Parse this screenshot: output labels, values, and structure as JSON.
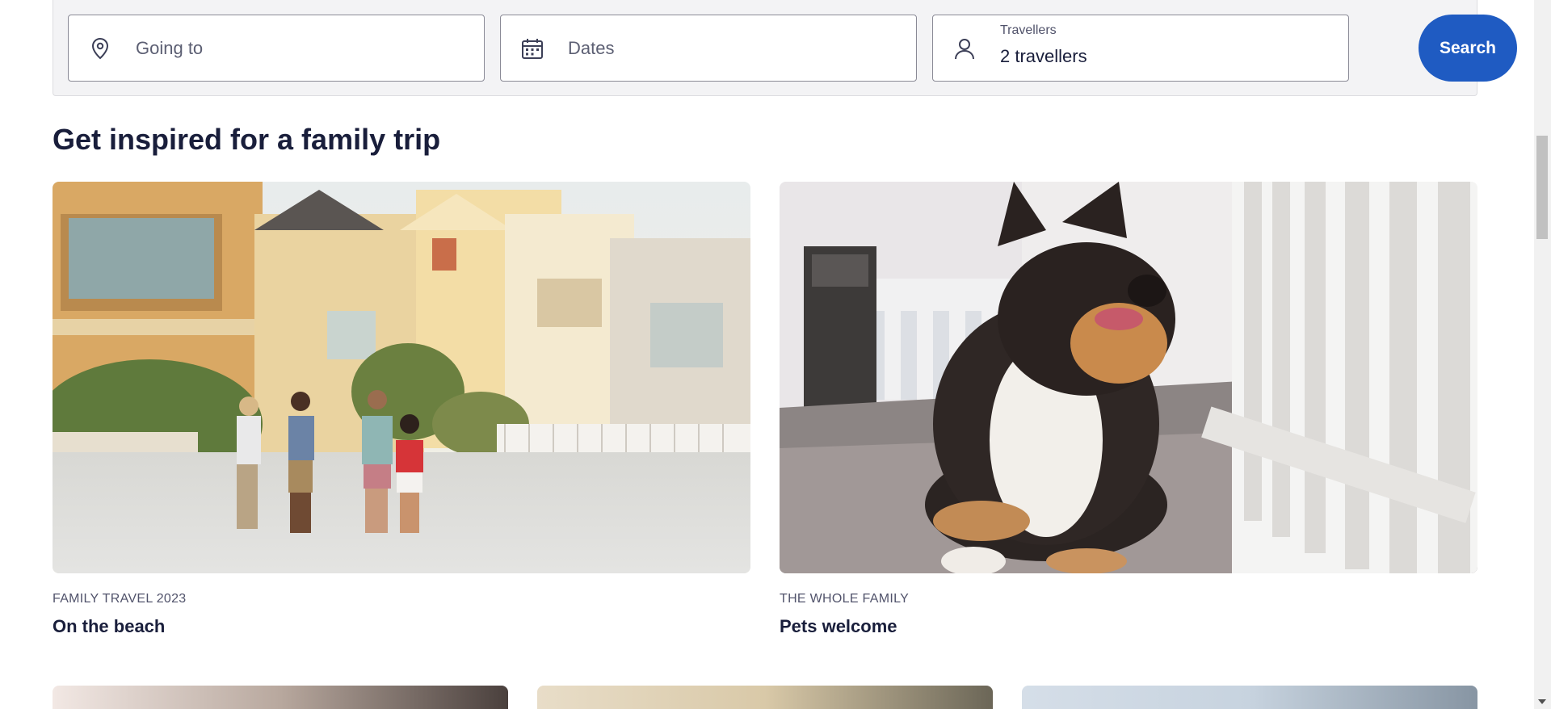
{
  "search": {
    "going_to_placeholder": "Going to",
    "dates_placeholder": "Dates",
    "travellers_label": "Travellers",
    "travellers_value": "2 travellers",
    "search_button": "Search"
  },
  "section": {
    "title": "Get inspired for a family trip"
  },
  "cards": [
    {
      "eyebrow": "FAMILY TRAVEL 2023",
      "title": "On the beach"
    },
    {
      "eyebrow": "THE WHOLE FAMILY",
      "title": "Pets welcome"
    }
  ],
  "colors": {
    "accent": "#1f5bc2",
    "text": "#191e3b",
    "muted": "#51536b",
    "panel": "#f3f3f5"
  },
  "icons": {
    "going_to": "map-pin-icon",
    "dates": "calendar-icon",
    "travellers": "person-icon"
  }
}
